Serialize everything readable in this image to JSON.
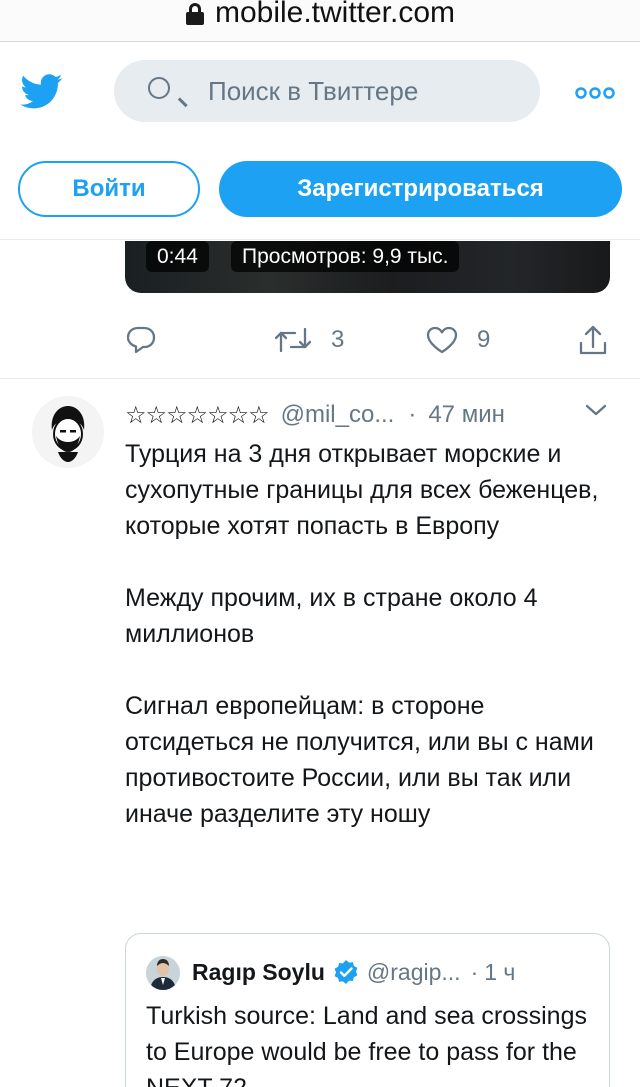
{
  "browser": {
    "url": "mobile.twitter.com"
  },
  "header": {
    "search_placeholder": "Поиск в Твиттере",
    "login_label": "Войти",
    "signup_label": "Зарегистрироваться",
    "icons": {
      "logo": "twitter-bird-icon",
      "search": "search-icon",
      "more": "more-dots-icon"
    },
    "accent_color": "#1da1f2"
  },
  "previous_tweet": {
    "video_duration": "0:44",
    "video_views": "Просмотров: 9,9 тыс.",
    "retweets": "3",
    "likes": "9"
  },
  "tweet": {
    "author_name": "☆☆☆☆☆☆☆",
    "handle": "@mil_co...",
    "dot": "·",
    "time": "47 мин",
    "paragraphs": [
      "Турция на 3 дня открывает морские и сухопутные границы для всех беженцев, которые хотят попасть в Европу",
      "Между прочим, их в стране около 4 миллионов",
      "Сигнал европейцам: в стороне отсидеться не получится, или вы с нами противостоите России, или вы так или иначе разделите эту ношу"
    ]
  },
  "quoted_tweet": {
    "author_name": "Ragıp Soylu",
    "handle": "@ragip...",
    "dot": "·",
    "time": "1 ч",
    "text": "Turkish source: Land and sea crossings to Europe would be free to pass for the NEXT 72"
  }
}
